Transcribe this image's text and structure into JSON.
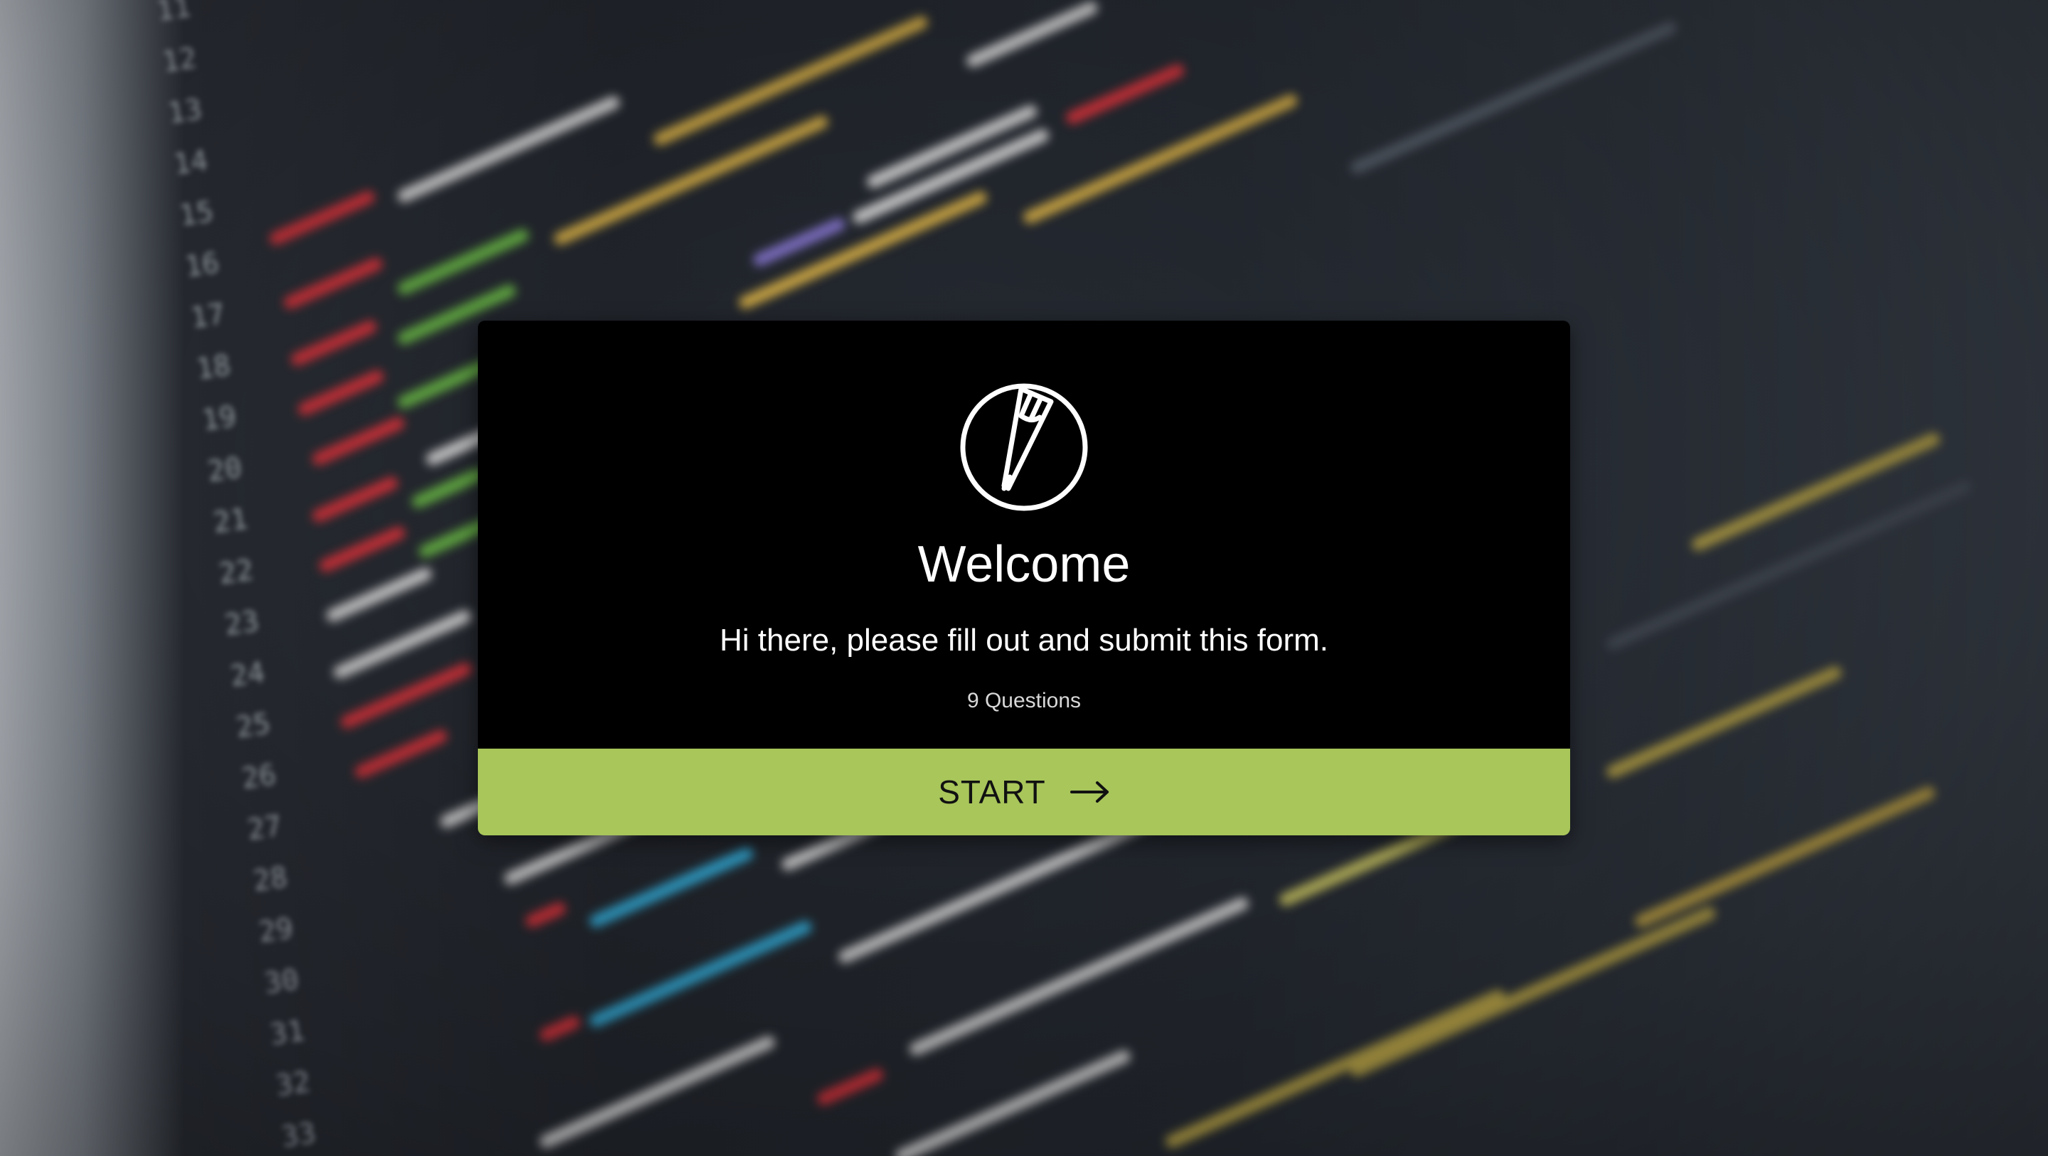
{
  "welcome": {
    "title": "Welcome",
    "subtitle": "Hi there, please fill out and submit this form.",
    "question_count": "9 Questions",
    "logo_icon": "pencil-circle-icon"
  },
  "start_button": {
    "label": "START",
    "icon": "arrow-right-icon"
  },
  "colors": {
    "accent": "#a8c65a",
    "card_background": "#000000"
  }
}
